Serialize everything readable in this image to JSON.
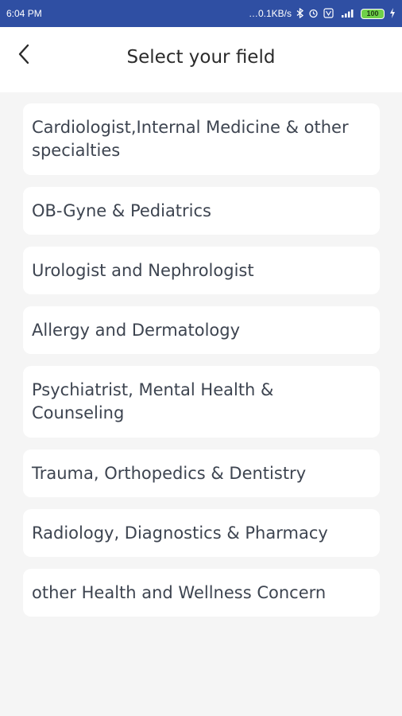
{
  "status_bar": {
    "time": "6:04 PM",
    "network_speed": "…0.1KB/s",
    "icons": [
      "bluetooth-icon",
      "alarm-icon",
      "vo-lte-icon",
      "signal-icon",
      "battery-icon",
      "charging-icon"
    ],
    "battery_level": "100"
  },
  "header": {
    "back_icon": "chevron-left-icon",
    "title": "Select your field"
  },
  "fields": [
    {
      "label": "Cardiologist,Internal Medicine & other specialties"
    },
    {
      "label": "OB-Gyne & Pediatrics"
    },
    {
      "label": "Urologist and Nephrologist"
    },
    {
      "label": "Allergy and Dermatology"
    },
    {
      "label": "Psychiatrist, Mental Health & Counseling"
    },
    {
      "label": "Trauma, Orthopedics & Dentistry"
    },
    {
      "label": "Radiology, Diagnostics & Pharmacy"
    },
    {
      "label": "other Health and Wellness Concern"
    }
  ],
  "colors": {
    "status_bar": "#2f4fa3",
    "background": "#f5f5f5",
    "card": "#ffffff",
    "text": "#3d4450"
  }
}
